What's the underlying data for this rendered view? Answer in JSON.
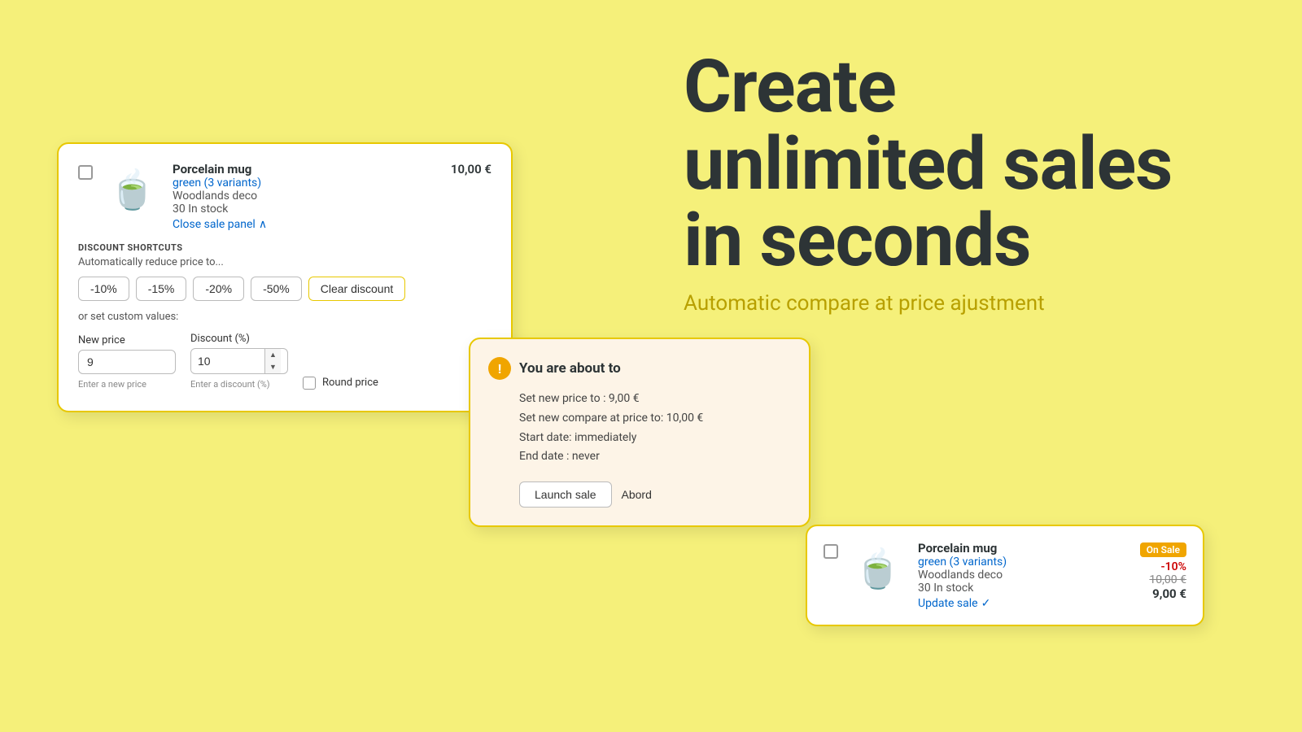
{
  "background": "#f5f07a",
  "headline": {
    "line1": "Create",
    "line2": "unlimited sales",
    "line3": "in seconds",
    "subtitle": "Automatic compare at price ajustment"
  },
  "main_card": {
    "product": {
      "name": "Porcelain mug",
      "variants_label": "green (3 variants)",
      "collection": "Woodlands deco",
      "stock": "30 In stock",
      "close_sale_label": "Close sale panel",
      "price": "10,00 €"
    },
    "discount_section": {
      "label": "DISCOUNT SHORTCUTS",
      "auto_reduce_text": "Automatically reduce price to...",
      "buttons": [
        "-10%",
        "-15%",
        "-20%",
        "-50%",
        "Clear discount"
      ],
      "or_custom_text": "or set custom values:",
      "new_price_label": "New price",
      "new_price_value": "9",
      "new_price_hint": "Enter a new price",
      "discount_label": "Discount (%)",
      "discount_value": "10",
      "discount_hint": "Enter a discount (%)",
      "round_price_label": "Round price"
    }
  },
  "confirm_card": {
    "icon": "!",
    "title": "You are about to",
    "details": [
      "Set new price to : 9,00 €",
      "Set new compare at price to: 10,00 €",
      "Start date: immediately",
      "End date : never"
    ],
    "launch_label": "Launch sale",
    "abort_label": "Abord"
  },
  "onsale_card": {
    "product": {
      "name": "Porcelain mug",
      "variants_label": "green (3 variants)",
      "collection": "Woodlands deco",
      "stock": "30 In stock",
      "update_sale_label": "Update sale"
    },
    "pricing": {
      "badge": "On Sale",
      "discount_pct": "-10%",
      "old_price": "10,00 €",
      "new_price": "9,00 €"
    }
  }
}
